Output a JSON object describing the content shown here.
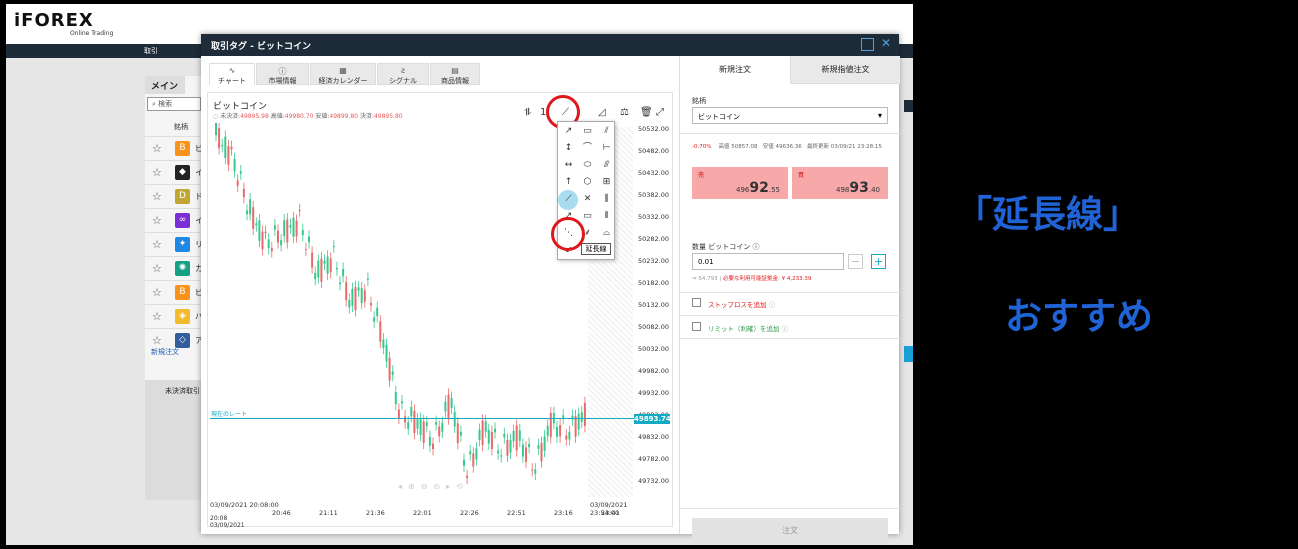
{
  "background": {
    "logo": "iFOREX",
    "logo_sub": "Online Trading",
    "nav": "取引",
    "tab_main": "メイン",
    "search_placeholder": "検索",
    "column_symbol": "銘柄",
    "rows": [
      {
        "color": "#f7931a",
        "glyph": "B",
        "char": "ビ"
      },
      {
        "color": "#222222",
        "glyph": "◆",
        "char": "イ"
      },
      {
        "color": "#c2a633",
        "glyph": "D",
        "char": "ド"
      },
      {
        "color": "#7b2fd6",
        "glyph": "∞",
        "char": "イ"
      },
      {
        "color": "#1e88e5",
        "glyph": "✦",
        "char": "リ"
      },
      {
        "color": "#16a085",
        "glyph": "✺",
        "char": "カ"
      },
      {
        "color": "#f7931a",
        "glyph": "B",
        "char": "ビ"
      },
      {
        "color": "#f3ba2f",
        "glyph": "◈",
        "char": "バ"
      },
      {
        "color": "#345d9d",
        "glyph": "◇",
        "char": "ア"
      }
    ],
    "new_order": "新規注文",
    "positions": "未決済取引"
  },
  "dialog": {
    "title": "取引タグ - ビットコイン",
    "tabs": [
      {
        "icon": "∿",
        "label": "チャート"
      },
      {
        "icon": "ⓘ",
        "label": "市場情報"
      },
      {
        "icon": "▦",
        "label": "経済カレンダー"
      },
      {
        "icon": "ƨ",
        "label": "シグナル"
      },
      {
        "icon": "▤",
        "label": "商品情報"
      }
    ]
  },
  "chart": {
    "symbol": "ビットコイン",
    "q_open_label": "未決済:",
    "q_open": "49895.98",
    "q_high_label": "高値:",
    "q_high": "49980.70",
    "q_low_label": "安値:",
    "q_low": "49899.80",
    "q_close_label": "決済:",
    "q_close": "49895.80",
    "price_labels": [
      "50532.00",
      "50482.00",
      "50432.00",
      "50382.00",
      "50332.00",
      "50282.00",
      "50232.00",
      "50182.00",
      "50132.00",
      "50082.00",
      "50032.00",
      "49982.00",
      "49932.00",
      "49882.00",
      "49832.00",
      "49782.00",
      "49732.00"
    ],
    "current_price": "49893.74",
    "current_rate_label": "現在のレート",
    "x_start": "03/09/2021 20:08:00",
    "x_end": "03/09/2021 23:54:00",
    "x_ticks": [
      "20:46",
      "21:11",
      "21:36",
      "22:01",
      "22:26",
      "22:51",
      "23:16",
      "23:41"
    ],
    "x_bottom_l1": "20:08",
    "x_bottom_l2": "03/09/2021",
    "tooltip": "延長線"
  },
  "order": {
    "tab_new": "新規注文",
    "tab_limit": "新規指値注文",
    "symbol_label": "銘柄",
    "symbol_value": "ビットコイン",
    "change": "-0.70%",
    "high_label": "高値",
    "high": "50857.08",
    "low_label": "安値",
    "low": "49636.36",
    "updated_label": "最終更新",
    "updated": "03/09/21 23:28:15",
    "sell_label": "売",
    "sell_small": "496",
    "sell_big": "92",
    "sell_tail": ".55",
    "buy_label": "買",
    "buy_small": "498",
    "buy_big": "93",
    "buy_tail": ".40",
    "qty_label": "数量 ビットコイン",
    "qty_value": "0.01",
    "qty_conv": "⇒ 54,793",
    "margin_label": "必要な利用可能証拠金",
    "margin_value": "¥ 4,233.39",
    "stoploss": "ストップロスを追加",
    "limit": "リミット（利確）を追加",
    "submit": "注文"
  },
  "annotation": {
    "line1": "「延長線」",
    "line2": "おすすめ"
  },
  "colors": {
    "accent": "#15aac3",
    "red": "#e0181c",
    "bull": "#35c98e",
    "bear": "#ea6a6a"
  }
}
